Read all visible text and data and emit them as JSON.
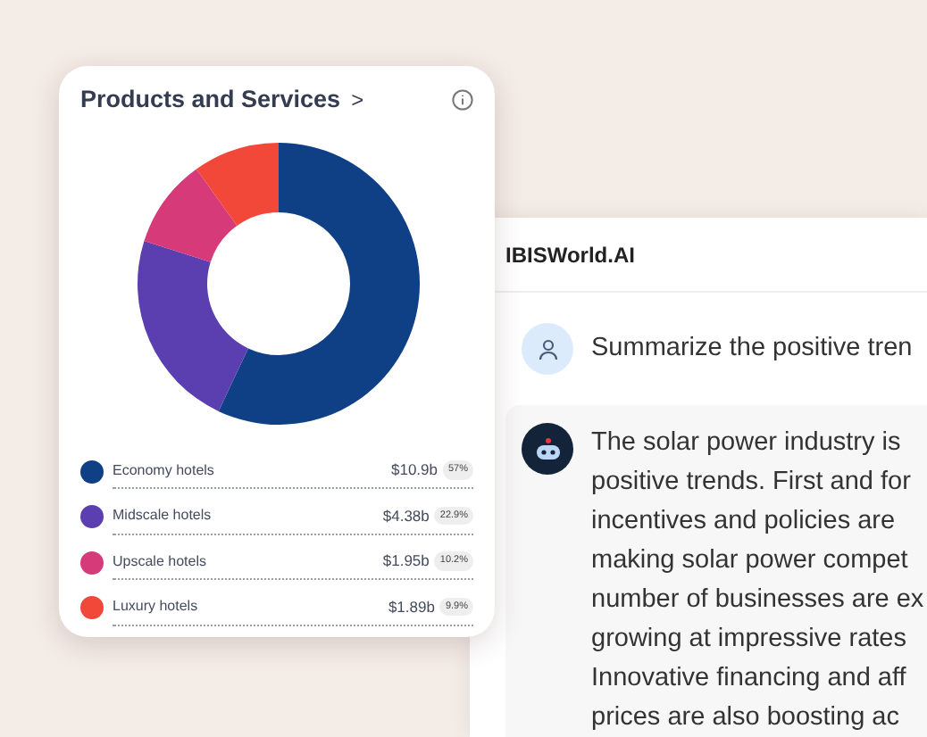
{
  "card": {
    "title": "Products and Services",
    "title_caret": ">",
    "chart_data": {
      "type": "donut",
      "categories": [
        "Economy hotels",
        "Midscale hotels",
        "Upscale hotels",
        "Luxury hotels"
      ],
      "values": [
        57,
        22.9,
        10.2,
        9.9
      ]
    },
    "legend": [
      {
        "value": "$10.9b",
        "share": "57%",
        "color": "#0f3f85"
      },
      {
        "value": "$4.38b",
        "share": "22.9%",
        "color": "#5b3fb0"
      },
      {
        "value": "$1.95b",
        "share": "10.2%",
        "color": "#d63a78"
      },
      {
        "value": "$1.89b",
        "share": "9.9%",
        "color": "#f2483a"
      }
    ]
  },
  "chat": {
    "title": "IBISWorld.AI",
    "messages": [
      {
        "kind": "user",
        "lines": [
          "Summarize the positive tren"
        ]
      },
      {
        "kind": "bot",
        "lines": [
          "The solar power industry is",
          "positive trends. First and for",
          "incentives and policies are",
          "making solar power compet",
          "number of businesses are ex",
          "growing at impressive rates",
          "Innovative financing and aff",
          "prices are also boosting ac"
        ]
      }
    ]
  }
}
